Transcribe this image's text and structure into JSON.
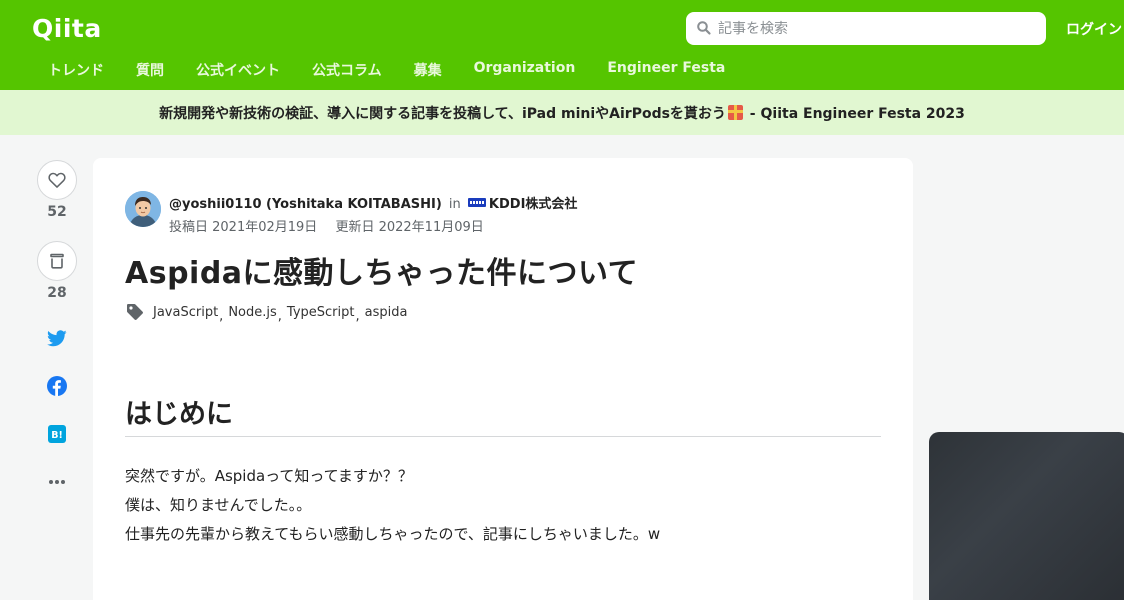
{
  "header": {
    "logo": "Qiita",
    "search_placeholder": "記事を検索",
    "login_label": "ログイン",
    "nav": [
      "トレンド",
      "質問",
      "公式イベント",
      "公式コラム",
      "募集",
      "Organization",
      "Engineer Festa"
    ]
  },
  "banner": {
    "text_before": "新規開発や新技術の検証、導入に関する記事を投稿して、iPad miniやAirPodsを貰おう",
    "text_after": " - Qiita Engineer Festa 2023"
  },
  "actions": {
    "likes": "52",
    "stocks": "28"
  },
  "article": {
    "author": "@yoshii0110 (Yoshitaka KOITABASHI)",
    "in_label": "in",
    "org": "KDDI株式会社",
    "posted": "投稿日 2021年02月19日",
    "updated": "更新日 2022年11月09日",
    "title": "Aspidaに感動しちゃった件について",
    "tags": [
      "JavaScript",
      "Node.js",
      "TypeScript",
      "aspida"
    ],
    "heading": "はじめに",
    "paragraphs": [
      "突然ですが。Aspidaって知ってますか？？",
      "僕は、知りませんでした。。",
      "仕事先の先輩から教えてもらい感動しちゃったので、記事にしちゃいました。w"
    ]
  },
  "colors": {
    "brand": "#55c500",
    "banner_bg": "#e1f7d1",
    "twitter": "#1d9bf0",
    "facebook": "#1877f2",
    "hatena": "#00a4de"
  }
}
